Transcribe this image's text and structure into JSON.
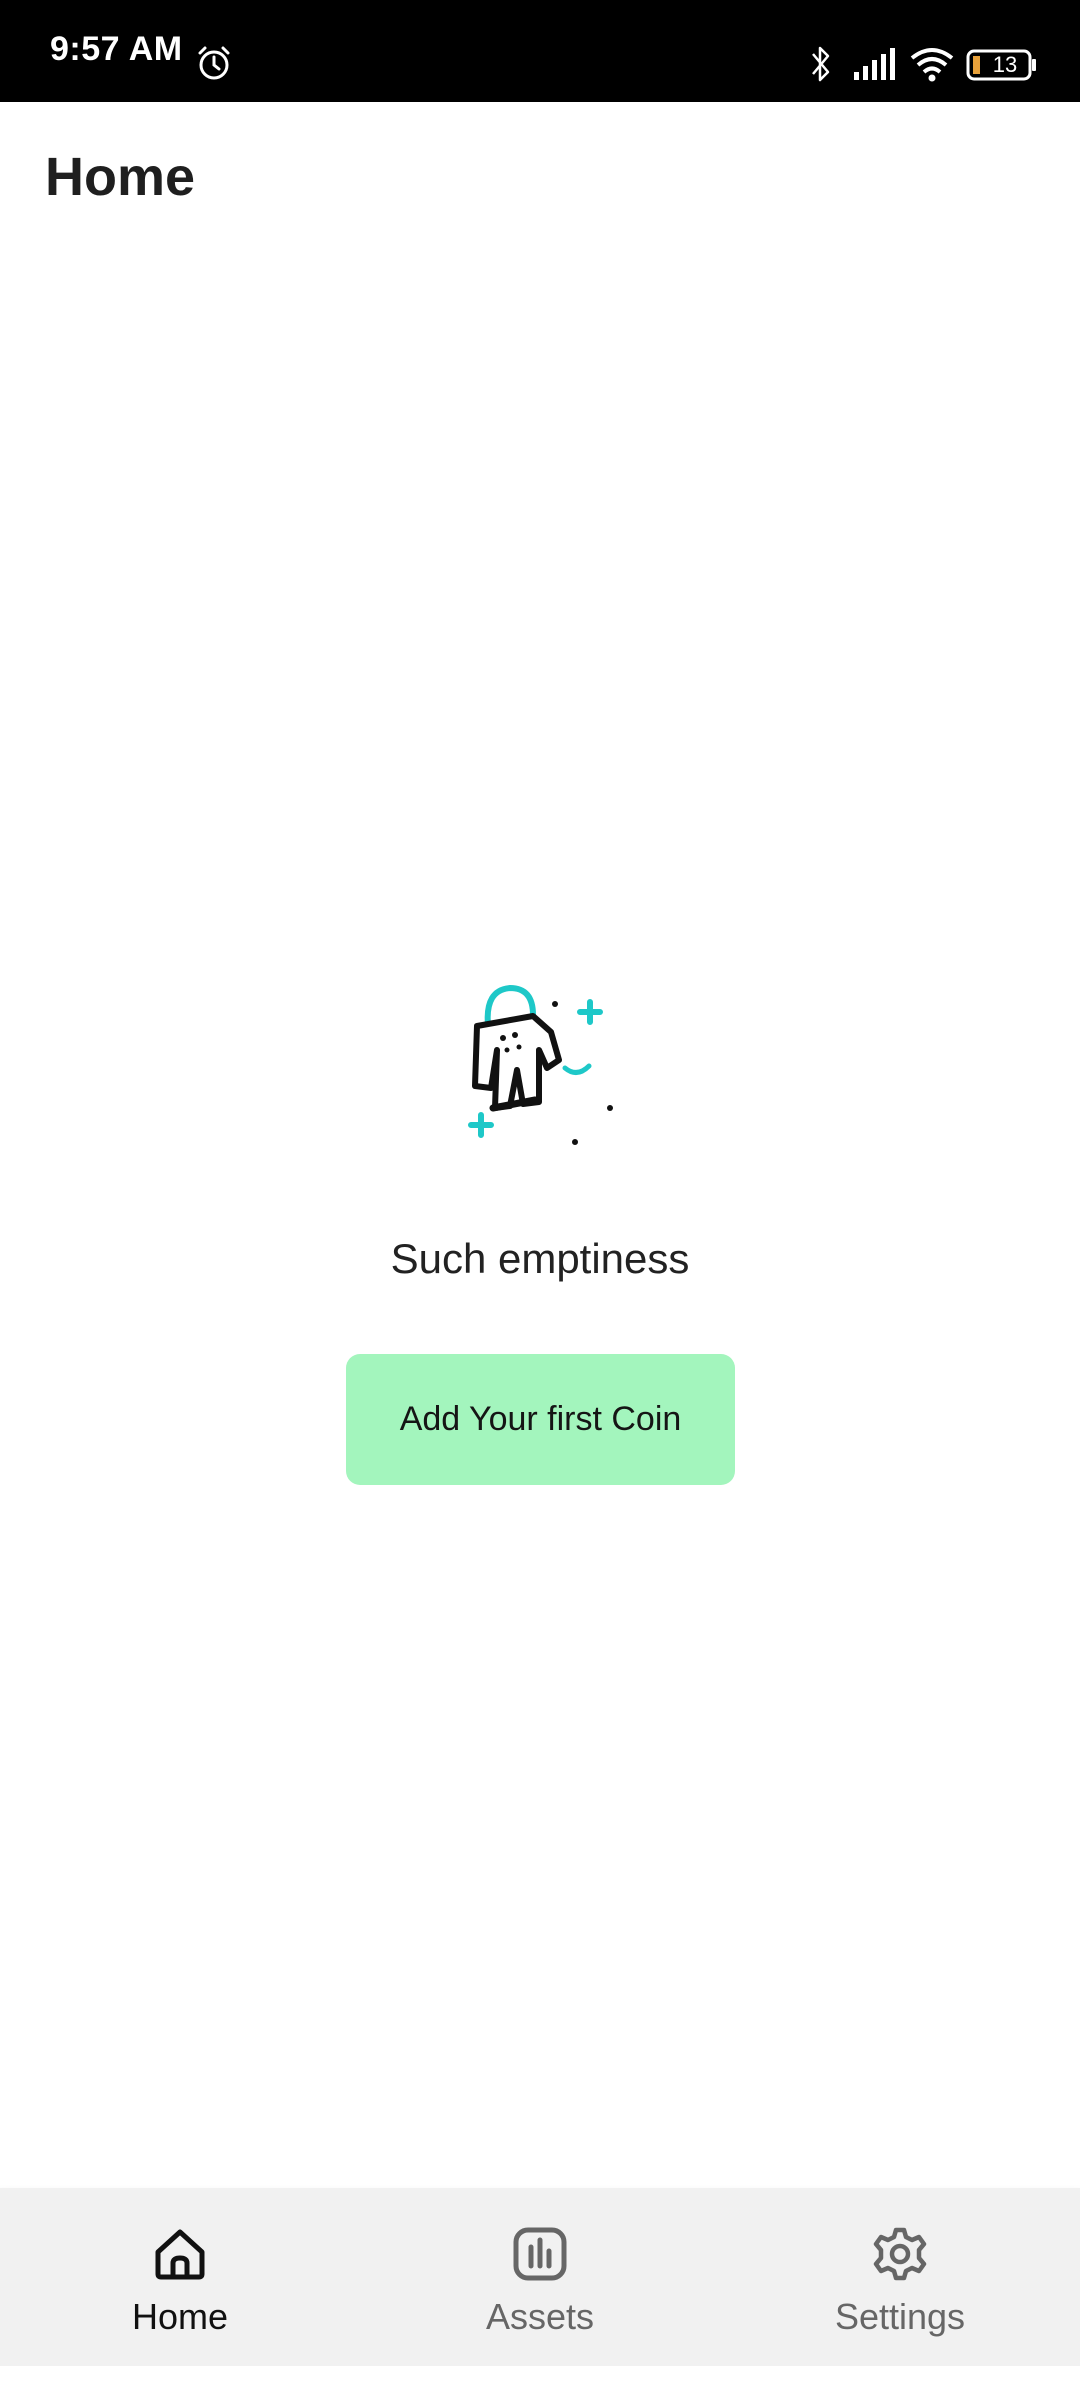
{
  "status_bar": {
    "time": "9:57 AM",
    "battery": "13",
    "icons": [
      "alarm-icon",
      "bluetooth-icon",
      "signal-icon",
      "wifi-icon",
      "battery-icon"
    ]
  },
  "header": {
    "title": "Home"
  },
  "empty_state": {
    "illustration": "astronaut-icon",
    "message": "Such emptiness",
    "button_label": "Add Your first Coin",
    "accent_color": "#a3f5bd",
    "illustration_accent": "#1ec8c8"
  },
  "bottom_nav": {
    "items": [
      {
        "label": "Home",
        "icon": "home-icon",
        "active": true
      },
      {
        "label": "Assets",
        "icon": "chart-icon",
        "active": false
      },
      {
        "label": "Settings",
        "icon": "gear-icon",
        "active": false
      }
    ]
  }
}
